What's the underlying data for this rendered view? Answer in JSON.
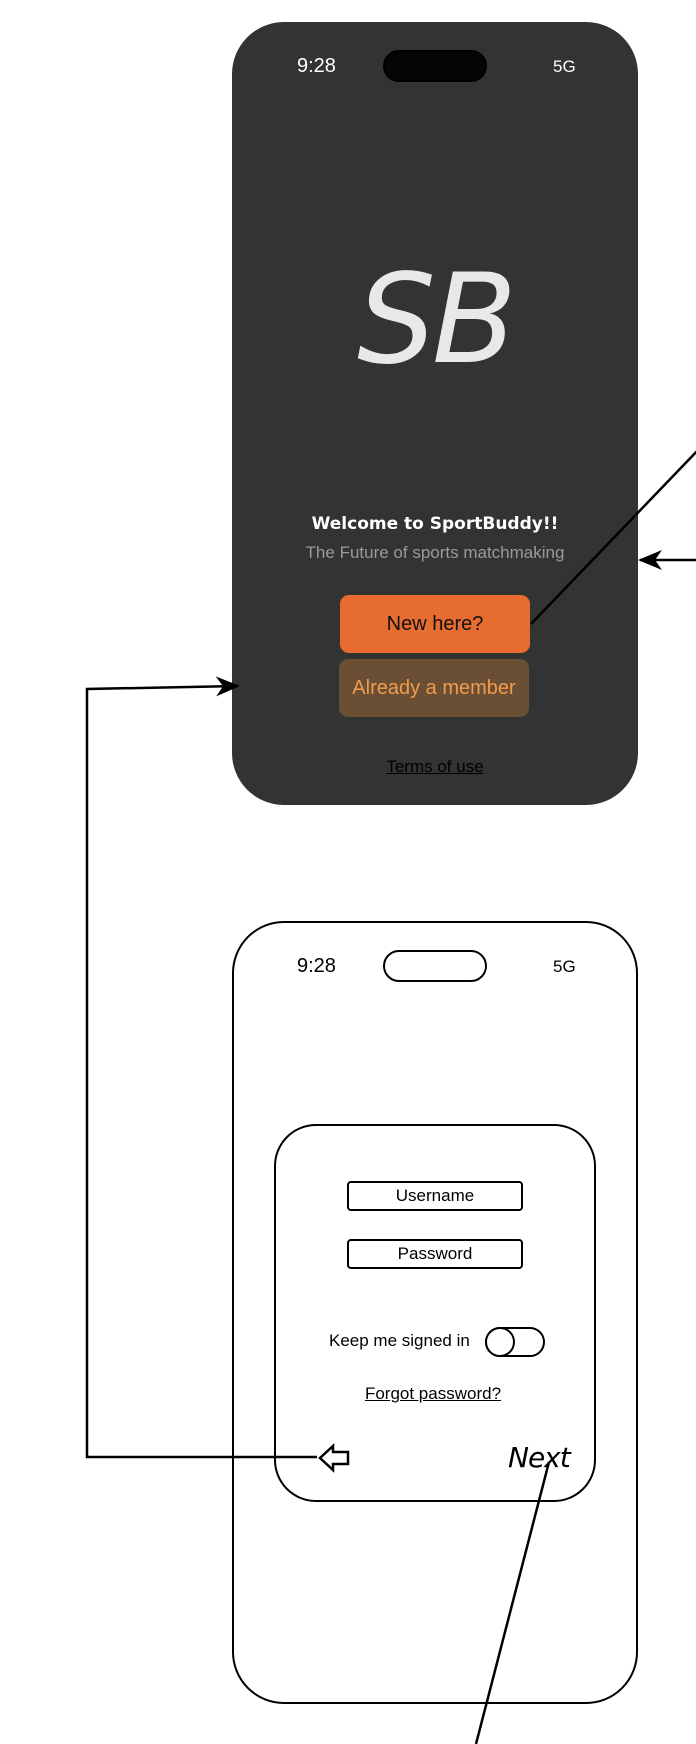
{
  "welcome_screen": {
    "status_time": "9:28",
    "status_network": "5G",
    "logo": "SB",
    "welcome_title": "Welcome to SportBuddy!!",
    "tagline": "The Future of sports matchmaking",
    "new_button": "New here?",
    "member_button": "Already a member",
    "terms_link": "Terms of use"
  },
  "login_screen": {
    "status_time": "9:28",
    "status_network": "5G",
    "username_field": "Username",
    "password_field": "Password",
    "keep_signed_in_label": "Keep me signed in",
    "forgot_password_link": "Forgot password?",
    "back_icon": "left-arrow-icon",
    "next_label": "Next"
  },
  "colors": {
    "dark_screen_bg": "#333333",
    "new_button_bg": "#e66d2f",
    "member_button_bg": "#6a4f35",
    "member_button_text": "#f39b4c",
    "tagline_text": "#9a9a9a"
  }
}
